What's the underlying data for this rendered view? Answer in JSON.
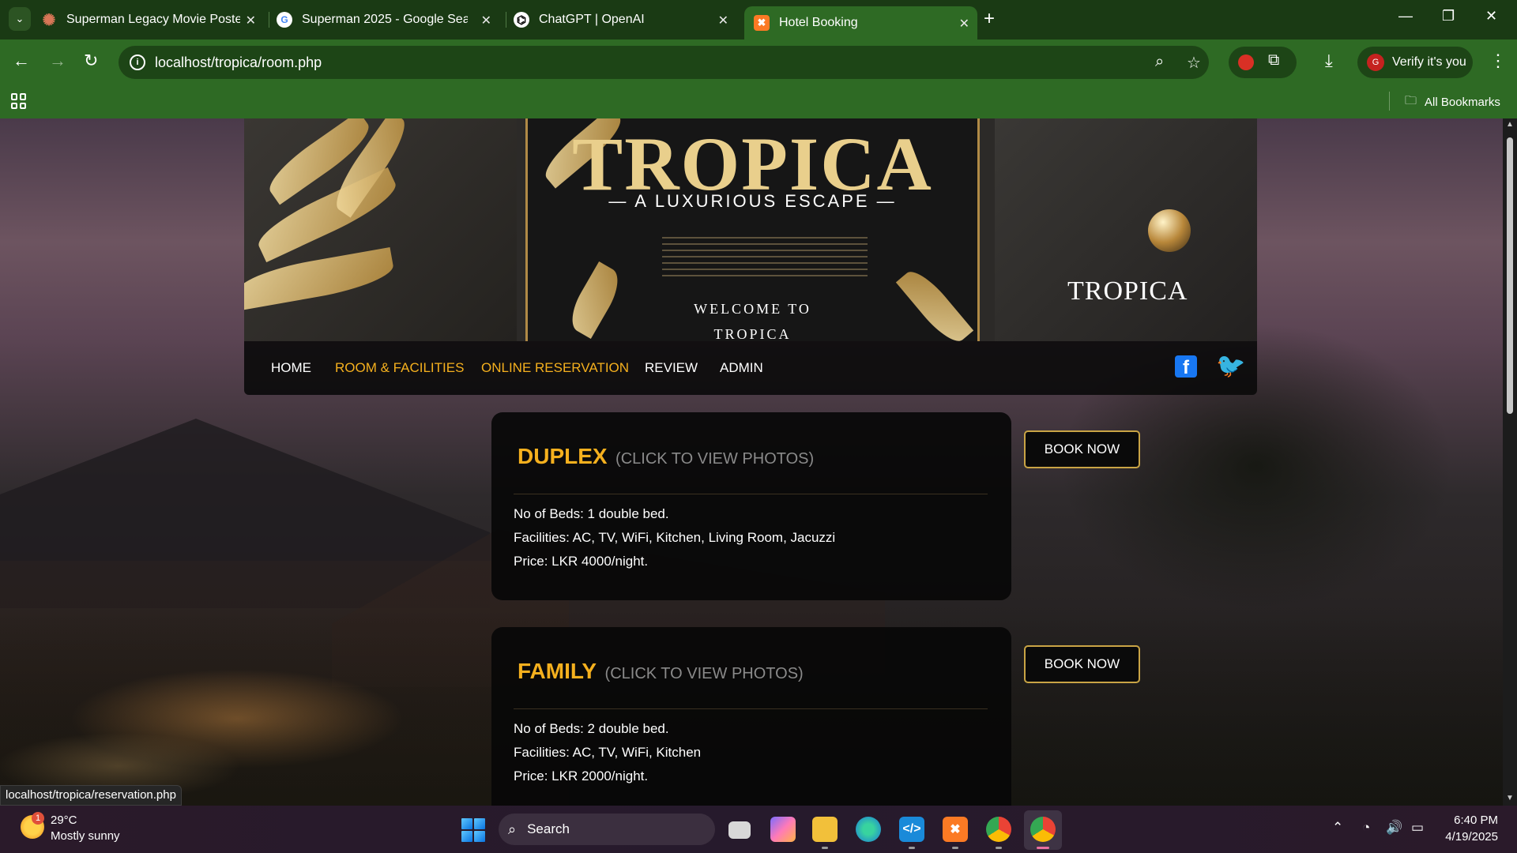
{
  "browser": {
    "tabs": [
      {
        "title": "Superman Legacy Movie Poster",
        "icon": "claude-icon"
      },
      {
        "title": "Superman 2025 - Google Search",
        "icon": "google-icon"
      },
      {
        "title": "ChatGPT | OpenAI",
        "icon": "openai-icon"
      },
      {
        "title": "Hotel Booking",
        "icon": "xampp-icon",
        "active": true
      }
    ],
    "url": "localhost/tropica/room.php",
    "profile_label": "Verify it's you",
    "profile_initial": "G",
    "bookmarks_label": "All Bookmarks",
    "status_url": "localhost/tropica/reservation.php",
    "theme_color": "#2e6a24"
  },
  "banner": {
    "title": "TROPICA",
    "subtitle": "— A LUXURIOUS ESCAPE —",
    "welcome_line1": "WELCOME TO",
    "welcome_line2": "TROPICA",
    "brand": "TROPICA"
  },
  "nav": {
    "items": [
      {
        "label": "HOME"
      },
      {
        "label": "ROOM & FACILITIES",
        "highlight": true
      },
      {
        "label": "ONLINE RESERVATION",
        "highlight": true
      },
      {
        "label": "REVIEW"
      },
      {
        "label": "ADMIN"
      }
    ],
    "social": [
      "facebook-icon",
      "twitter-icon"
    ],
    "accent_color": "#f5b01e"
  },
  "rooms": [
    {
      "name": "DUPLEX",
      "hint": "(CLICK TO VIEW PHOTOS)",
      "beds": "No of Beds: 1 double bed.",
      "facilities": "Facilities: AC, TV, WiFi, Kitchen, Living Room, Jacuzzi",
      "price": "Price: LKR 4000/night.",
      "book_label": "BOOK NOW"
    },
    {
      "name": "FAMILY",
      "hint": "(CLICK TO VIEW PHOTOS)",
      "beds": "No of Beds: 2 double bed.",
      "facilities": "Facilities: AC, TV, WiFi, Kitchen",
      "price": "Price: LKR 2000/night.",
      "book_label": "BOOK NOW"
    }
  ],
  "taskbar": {
    "weather_temp": "29°C",
    "weather_desc": "Mostly sunny",
    "weather_badge": "1",
    "search_label": "Search",
    "time": "6:40 PM",
    "date": "4/19/2025"
  }
}
